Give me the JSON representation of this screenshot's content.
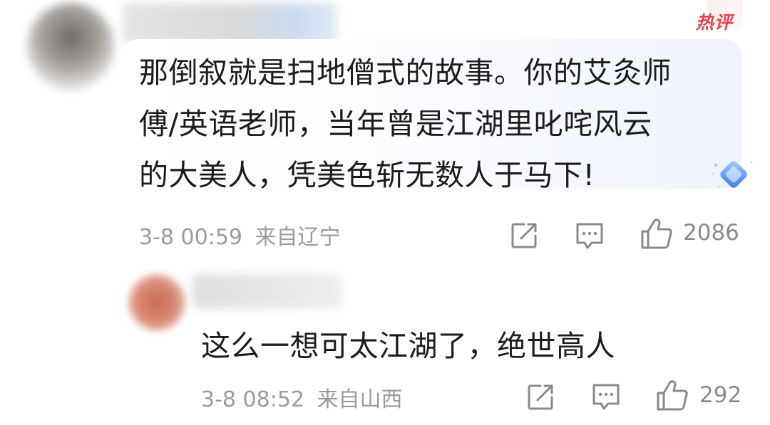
{
  "main_comment": {
    "badge": "热评",
    "text_lines": [
      "那倒叙就是扫地僧式的故事。你的艾灸师",
      "傅/英语老师，当年曾是江湖里叱咤风云",
      "的大美人，凭美色斩无数人于马下!"
    ],
    "time": "3-8 00:59",
    "location": "来自辽宁",
    "likes": "2086",
    "icons": [
      "share-icon",
      "comment-icon",
      "thumbs-up-icon",
      "diamond-badge-icon"
    ]
  },
  "reply_comment": {
    "text": "这么一想可太江湖了，绝世高人",
    "time": "3-8 08:52",
    "location": "来自山西",
    "likes": "292",
    "icons": [
      "share-icon",
      "comment-icon",
      "thumbs-up-icon"
    ]
  },
  "colors": {
    "badge_red": "#e8424a",
    "meta_gray": "#9b9b9b",
    "text_dark": "#1c1c1c",
    "bubble_blue": "#eef3fd"
  }
}
